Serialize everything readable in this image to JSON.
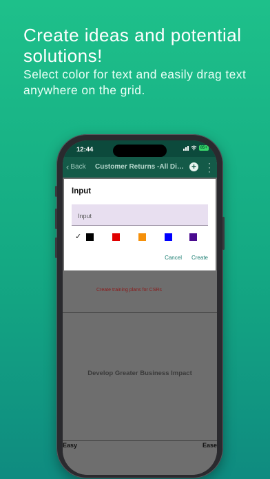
{
  "promo": {
    "headline": "Create ideas and potential solutions!",
    "subline": "Select color for text and easily drag text anywhere on the grid."
  },
  "statusbar": {
    "time": "12:44",
    "battery": "85+"
  },
  "navbar": {
    "back_label": "Back",
    "title": "Customer Returns -All Div...",
    "add_icon": "plus-circle-icon",
    "more_icon": "more-vertical-icon"
  },
  "dialog": {
    "title": "Input",
    "input_placeholder": "Input",
    "colors": [
      "#000000",
      "#e00000",
      "#f5900a",
      "#0000ff",
      "#4a0b8f"
    ],
    "selected_color_index": 0,
    "cancel_label": "Cancel",
    "create_label": "Create"
  },
  "grid": {
    "note_text": "Create training plans for CSRs",
    "note_color": "#8b1a1a",
    "center_label": "Develop Greater Business Impact",
    "bottom_left_label": "Easy",
    "bottom_right_label": "Ease"
  }
}
